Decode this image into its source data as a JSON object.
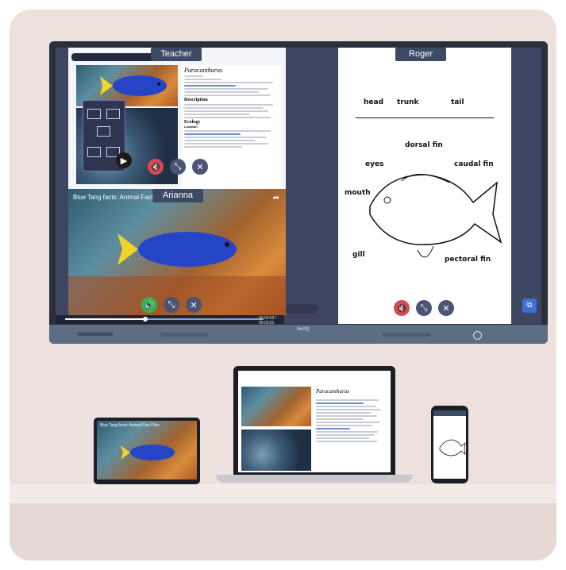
{
  "screen": {
    "labels": {
      "teacher": "Teacher",
      "roger": "Roger",
      "arianna": "Arianna"
    },
    "wiki": {
      "title": "Paracanthurus",
      "section_description": "Description",
      "section_ecology": "Ecology",
      "subsection_location": "Location"
    },
    "video": {
      "title": "Blue Tang facts: Animal Fact",
      "time": "00:03:22 / 00:03:51"
    },
    "drawing": {
      "labels": [
        "head",
        "trunk",
        "tail",
        "dorsal fin",
        "eyes",
        "caudal fin",
        "mouth",
        "gill",
        "pectoral fin"
      ]
    },
    "brand": "BenQ",
    "icons": [
      "mute-icon",
      "fullscreen-icon",
      "close-icon",
      "share-icon",
      "play-icon",
      "cast-icon"
    ]
  },
  "devices": {
    "tablet_video_title": "Blue Tang facts: Animal Fact Files",
    "laptop_wiki_title": "Paracanthurus"
  },
  "colors": {
    "panel_label": "#3c4a66",
    "mute_red": "#d44b55",
    "audio_green": "#35b24d",
    "control_grey": "#4b5474"
  }
}
